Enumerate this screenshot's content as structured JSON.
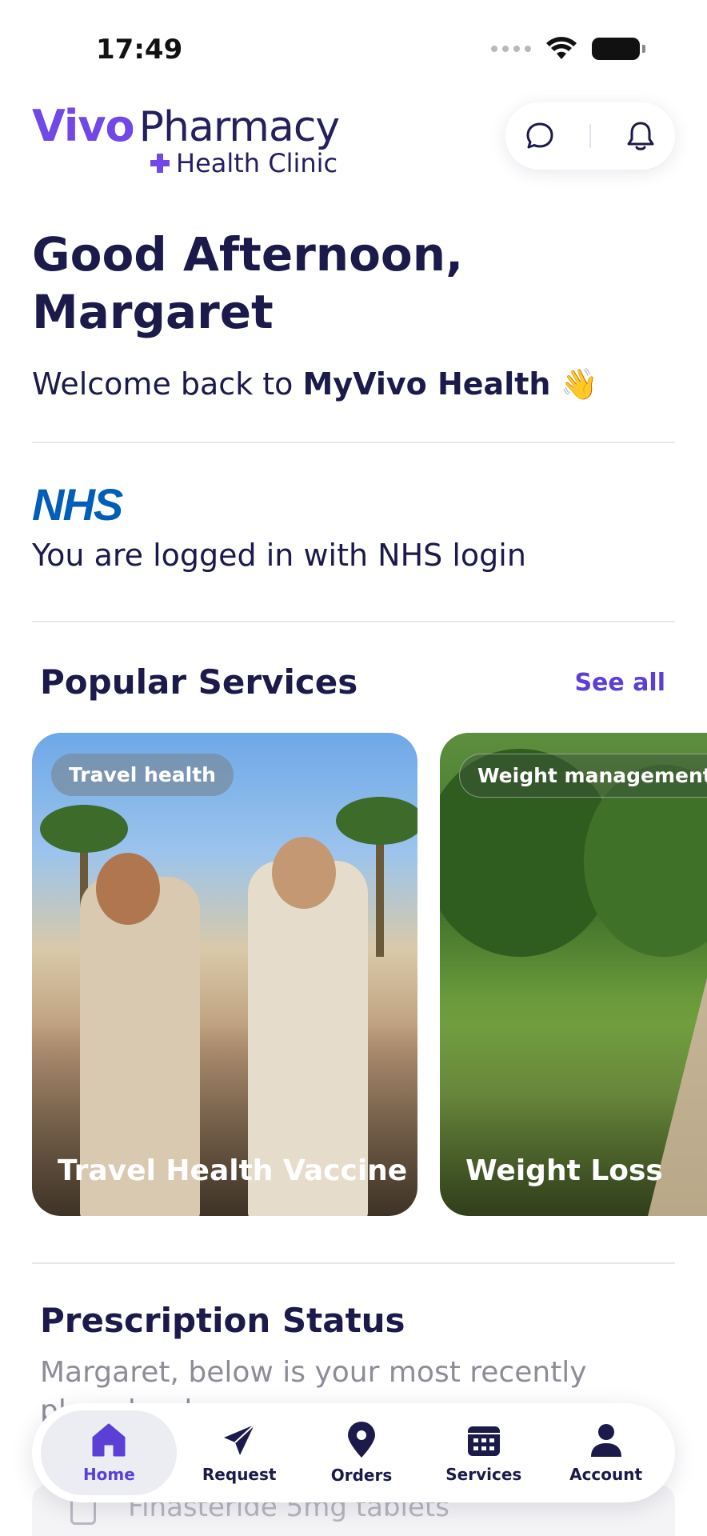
{
  "status_bar": {
    "time": "17:49"
  },
  "header": {
    "logo_vivo": "Vivo",
    "logo_pharmacy": "Pharmacy",
    "logo_clinic": "Health Clinic",
    "icons": [
      "chat-icon",
      "bell-icon"
    ]
  },
  "greeting": {
    "line1": "Good Afternoon,",
    "line2": "Margaret",
    "welcome_prefix": "Welcome back to ",
    "welcome_brand": "MyVivo Health",
    "welcome_emoji": "👋"
  },
  "nhs": {
    "logo": "NHS",
    "login_text": "You are logged in with NHS login"
  },
  "popular_services": {
    "title": "Popular Services",
    "see_all": "See all",
    "cards": [
      {
        "badge": "Travel health",
        "title": "Travel Health Vaccine"
      },
      {
        "badge": "Weight management",
        "title": "Weight Loss"
      }
    ]
  },
  "prescription": {
    "title": "Prescription Status",
    "subtitle": "Margaret, below is your most recently placed order",
    "item": "Finasteride 5mg tablets"
  },
  "nav": {
    "items": [
      {
        "label": "Home",
        "icon": "home-icon",
        "active": true
      },
      {
        "label": "Request",
        "icon": "send-icon",
        "active": false
      },
      {
        "label": "Orders",
        "icon": "location-pin-icon",
        "active": false
      },
      {
        "label": "Services",
        "icon": "calendar-icon",
        "active": false
      },
      {
        "label": "Account",
        "icon": "user-icon",
        "active": false
      }
    ]
  },
  "colors": {
    "brand_purple": "#7048e8",
    "navy": "#1b1a4b",
    "nhs_blue": "#005eb8",
    "link": "#5b3fd6"
  }
}
